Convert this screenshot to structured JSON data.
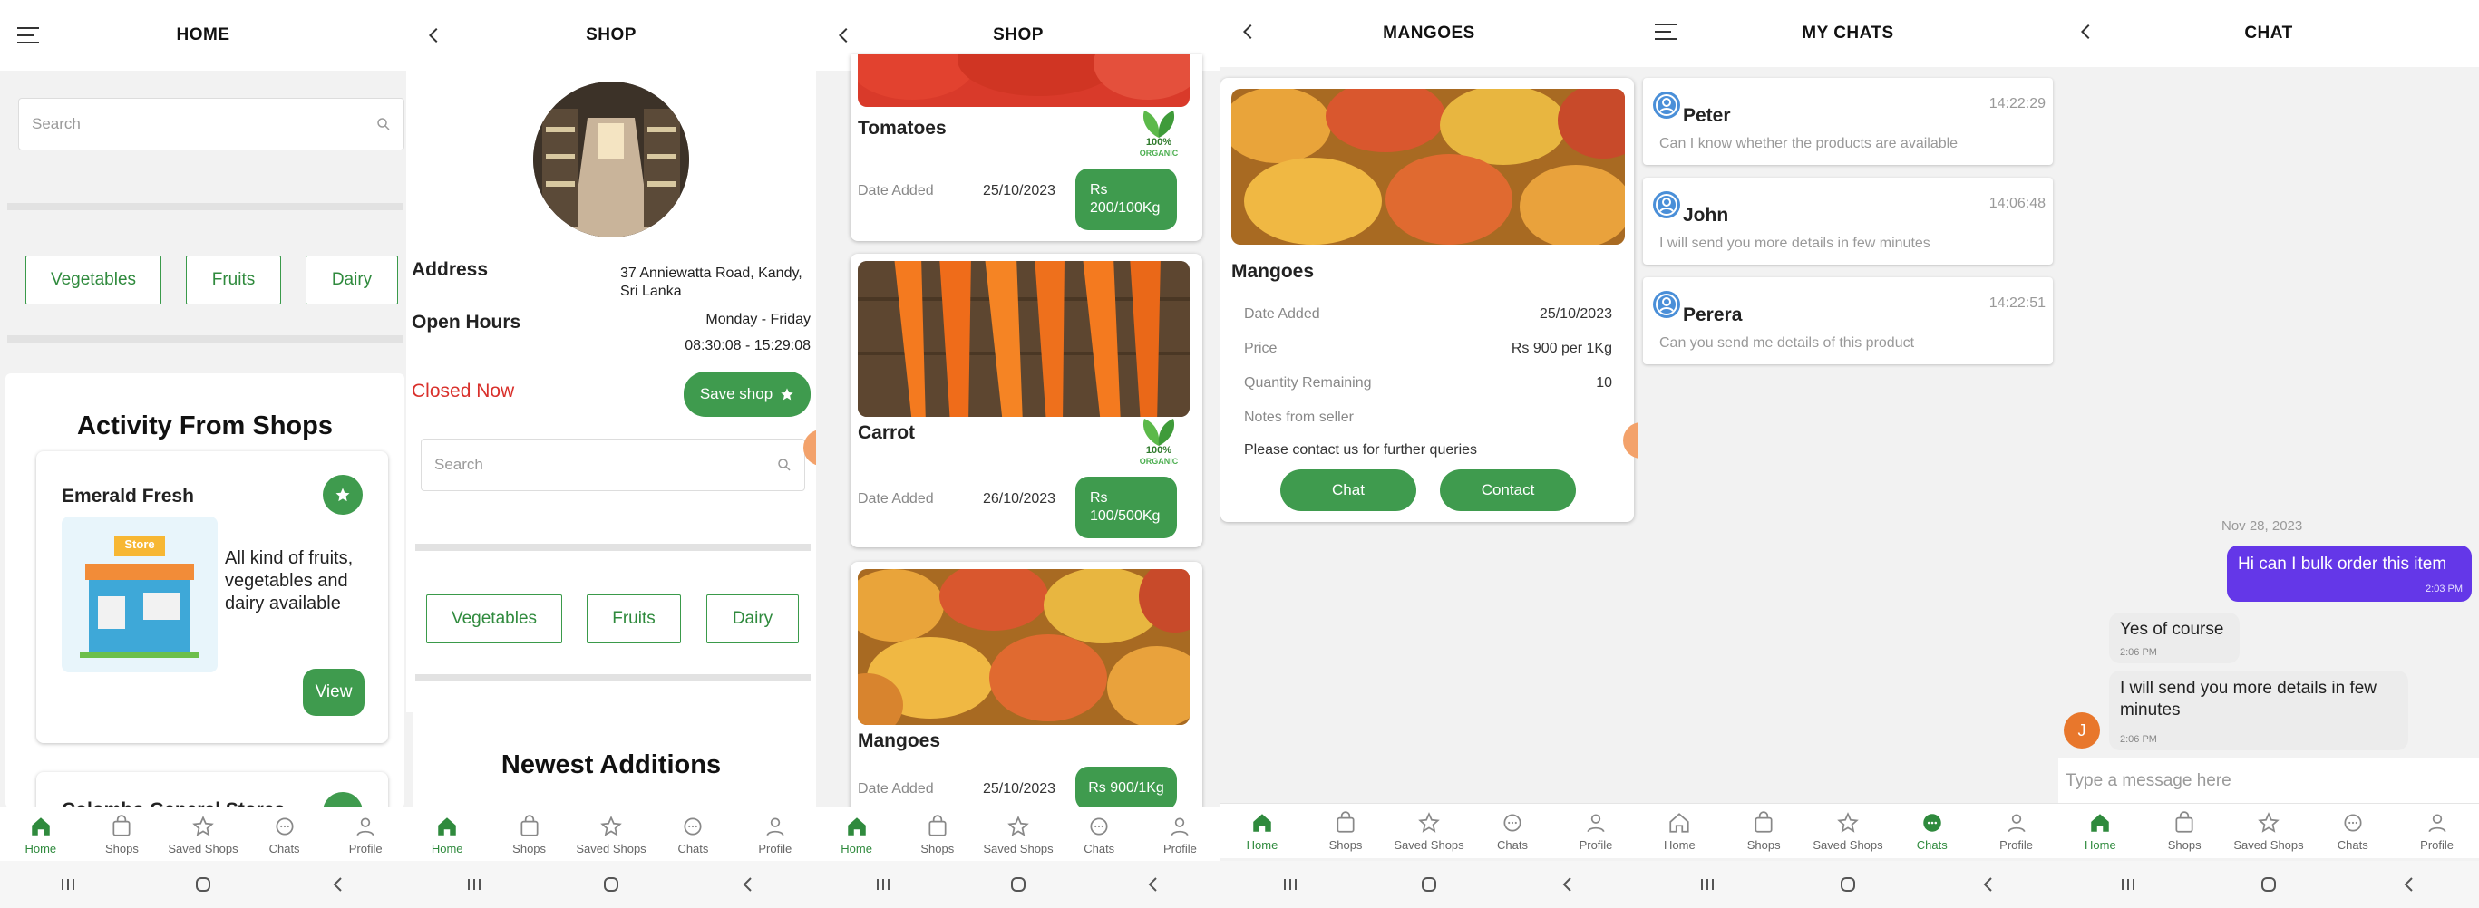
{
  "nav": {
    "home": "Home",
    "shops": "Shops",
    "saved": "Saved Shops",
    "chats": "Chats",
    "profile": "Profile"
  },
  "colors": {
    "accent": "#3f9b4e",
    "closed": "#d9302b",
    "chat_purple": "#6437e8"
  },
  "home": {
    "title": "HOME",
    "search_placeholder": "Search",
    "categories": [
      "Vegetables",
      "Fruits",
      "Dairy"
    ],
    "activity_title": "Activity From Shops",
    "shop1": {
      "name": "Emerald Fresh",
      "desc": "All kind of fruits, vegetables and dairy available",
      "view": "View",
      "store_sign": "Store"
    },
    "shop2": {
      "name": "Colombo General Stores"
    }
  },
  "shop": {
    "title": "SHOP",
    "address_label": "Address",
    "address_value": "37 Anniewatta Road, Kandy, Sri Lanka",
    "hours_label": "Open Hours",
    "hours_days": "Monday - Friday",
    "hours_time": "08:30:08 - 15:29:08",
    "status": "Closed Now",
    "save": "Save shop",
    "search_placeholder": "Search",
    "categories": [
      "Vegetables",
      "Fruits",
      "Dairy"
    ],
    "newest": "Newest Additions"
  },
  "shop2": {
    "title": "SHOP",
    "organic": "100%",
    "organic_sub": "ORGANIC",
    "items": [
      {
        "name": "Tomatoes",
        "date_label": "Date Added",
        "date": "25/10/2023",
        "price": "Rs 200/100Kg"
      },
      {
        "name": "Carrot",
        "date_label": "Date Added",
        "date": "26/10/2023",
        "price": "Rs 100/500Kg"
      },
      {
        "name": "Mangoes",
        "date_label": "Date Added",
        "date": "25/10/2023",
        "price": "Rs 900/1Kg"
      }
    ]
  },
  "mangoes": {
    "title": "MANGOES",
    "name": "Mangoes",
    "rows": [
      {
        "label": "Date Added",
        "value": "25/10/2023"
      },
      {
        "label": "Price",
        "value": "Rs 900 per 1Kg"
      },
      {
        "label": "Quantity Remaining",
        "value": "10"
      },
      {
        "label": "Notes from seller",
        "value": ""
      }
    ],
    "note": "Please contact us for further queries",
    "chat": "Chat",
    "contact": "Contact"
  },
  "mychats": {
    "title": "MY CHATS",
    "items": [
      {
        "name": "Peter",
        "time": "14:22:29",
        "msg": "Can I know whether the products are available"
      },
      {
        "name": "John",
        "time": "14:06:48",
        "msg": "I will send you more details in few minutes"
      },
      {
        "name": "Perera",
        "time": "14:22:51",
        "msg": "Can you send me details of this product"
      }
    ]
  },
  "chat": {
    "title": "CHAT",
    "date": "Nov 28, 2023",
    "out": {
      "text": "Hi can I bulk order this item",
      "time": "2:03 PM"
    },
    "in1": {
      "text": "Yes of course",
      "time": "2:06 PM"
    },
    "in2": {
      "text": "I will send you more details in few minutes",
      "time": "2:06 PM"
    },
    "avatar": "J",
    "input_placeholder": "Type a message here"
  }
}
